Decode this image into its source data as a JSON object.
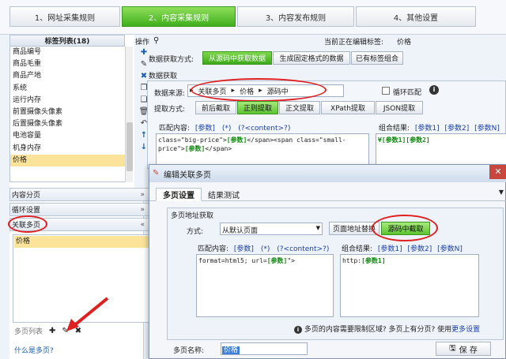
{
  "steps": [
    {
      "label": "1、网址采集规则",
      "active": false
    },
    {
      "label": "2、内容采集规则",
      "active": true
    },
    {
      "label": "3、内容发布规则",
      "active": false
    },
    {
      "label": "4、其他设置",
      "active": false
    }
  ],
  "tag_panel": {
    "title": "标签列表(18)",
    "tools_label": "操作",
    "items": [
      "商品编号",
      "商品毛重",
      "商品产地",
      "系统",
      "运行内存",
      "前置摄像头像素",
      "后置摄像头像素",
      "电池容量",
      "机身内存",
      "价格"
    ],
    "selected_item": "价格"
  },
  "accordion": {
    "content_paging": "内容分页",
    "loop_settings": "循环设置",
    "multipage": "关联多页"
  },
  "multipage_list": {
    "items": [
      "价格"
    ],
    "toolbar_label": "多页列表",
    "help_link": "什么是多页?"
  },
  "main": {
    "editing_label": "当前正在编辑标签:",
    "editing_tag": "价格",
    "fetch_mode_label": "数据获取方式:",
    "fetch_modes": [
      "从源码中获取数据",
      "生成固定格式的数据",
      "已有标签组合"
    ],
    "section_title": "数据获取",
    "data_source_label": "数据来源:",
    "data_source_path": [
      "关联多页",
      "价格",
      "源码中"
    ],
    "loop_match_label": "循环匹配",
    "extract_label": "提取方式:",
    "extract_methods": [
      "前后截取",
      "正则提取",
      "正文提取",
      "XPath提取",
      "JSON提取"
    ],
    "match_label": "匹配内容:",
    "match_param": "[参数]",
    "match_any": "(*)",
    "match_content": "(?<content>?)",
    "match_text_1": "class=\"big-price\">",
    "match_text_2": "</span><span class=\"small-",
    "match_text_3": "price\">",
    "match_text_4": "</span>",
    "combine_label": "组合结果:",
    "combine_params": [
      "[参数1]",
      "[参数2]",
      "[参数N]"
    ],
    "combine_text_prefix": "¥",
    "combine_text_p1": "[参数1]",
    "combine_text_p2": "[参数2]"
  },
  "dialog": {
    "title": "编辑关联多页",
    "tabs": [
      "多页设置",
      "结果测试"
    ],
    "section_title": "多页地址获取",
    "method_label": "方式:",
    "method_value": "从默认页面",
    "buttons": [
      "页面地址替换",
      "源码中截取"
    ],
    "match_label": "匹配内容:",
    "match_param": "[参数]",
    "match_any": "(*)",
    "match_content": "(?<content>?)",
    "match_text_1": "format=html5; url=",
    "match_text_2": "\">",
    "combine_label": "组合结果:",
    "combine_params": [
      "[参数1]",
      "[参数2]",
      "[参数N]"
    ],
    "combine_text": "http:",
    "combine_text_p1": "[参数1]",
    "hint": "多页的内容需要限制区域? 多页上有分页? 使用",
    "hint_link": "更多设置",
    "name_label": "多页名称:",
    "name_value": "价格",
    "save_button": "保 存"
  }
}
